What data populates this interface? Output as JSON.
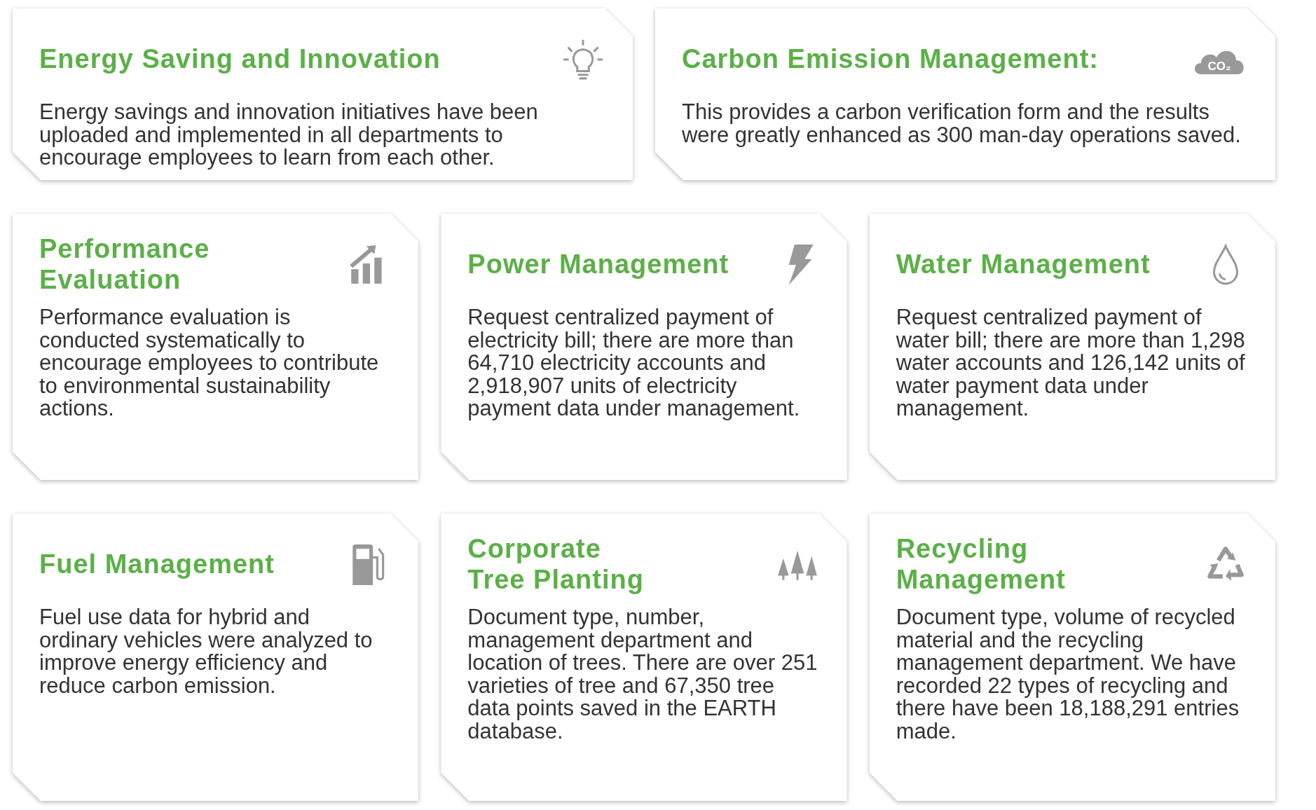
{
  "cards": [
    {
      "kind": "bulb",
      "title": [
        "Energy Saving and Innovation"
      ],
      "text": "Energy savings and innovation initiatives have been uploaded and implemented in all departments to encourage employees to learn from each other."
    },
    {
      "kind": "cloud",
      "icon_text": "CO₂",
      "title": [
        "Carbon Emission Management:"
      ],
      "text": "This provides a carbon verification form and the results were greatly enhanced as 300 man-day operations saved."
    },
    {
      "kind": "chart",
      "title": [
        "Performance",
        "Evaluation"
      ],
      "text": "Performance evaluation is conducted systematically to encourage employees to contribute to environmental sustainability actions."
    },
    {
      "kind": "bolt",
      "title": [
        "Power Management"
      ],
      "text": "Request centralized payment of electricity bill; there are more than 64,710 electricity accounts and 2,918,907 units of electricity payment data under management."
    },
    {
      "kind": "drop",
      "title": [
        "Water Management"
      ],
      "text": "Request centralized payment of water bill; there are more than 1,298 water accounts and 126,142 units of water payment data under management."
    },
    {
      "kind": "fuel",
      "title": [
        "Fuel Management"
      ],
      "text": "Fuel use data for hybrid and ordinary vehicles were analyzed to improve energy efficiency and reduce carbon emission."
    },
    {
      "kind": "trees",
      "title": [
        "Corporate",
        "Tree Planting"
      ],
      "text": "Document type, number, management department and location of trees. There are over 251 varieties of tree and 67,350 tree data points saved in the EARTH database."
    },
    {
      "kind": "recycle",
      "title": [
        "Recycling",
        "Management"
      ],
      "text": "Document type, volume of recycled material and the recycling management department. We have recorded 22 types of recycling and there have been 18,188,291 entries made."
    }
  ]
}
